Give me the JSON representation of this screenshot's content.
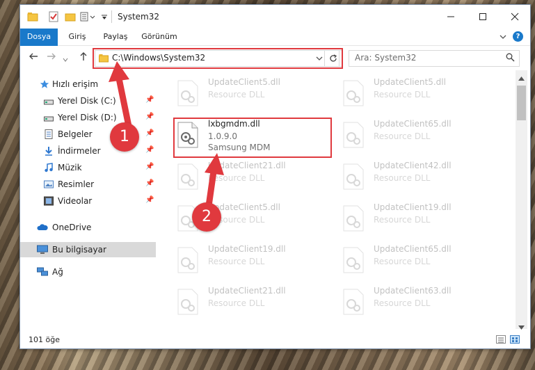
{
  "window": {
    "title": "System32"
  },
  "ribbon": {
    "tabs": [
      "Dosya",
      "Giriş",
      "Paylaş",
      "Görünüm"
    ]
  },
  "address": {
    "path": "C:\\Windows\\System32",
    "search_placeholder": "Ara: System32"
  },
  "sidebar": {
    "items": [
      {
        "label": "Hızlı erişim",
        "icon": "star-icon",
        "pinned": false
      },
      {
        "label": "Yerel Disk (C:)",
        "icon": "drive-icon",
        "pinned": true
      },
      {
        "label": "Yerel Disk (D:)",
        "icon": "drive-icon",
        "pinned": true
      },
      {
        "label": "Belgeler",
        "icon": "documents-icon",
        "pinned": true
      },
      {
        "label": "İndirmeler",
        "icon": "download-icon",
        "pinned": true
      },
      {
        "label": "Müzik",
        "icon": "music-icon",
        "pinned": true
      },
      {
        "label": "Resimler",
        "icon": "pictures-icon",
        "pinned": true
      },
      {
        "label": "Videolar",
        "icon": "video-icon",
        "pinned": true
      },
      {
        "label": "OneDrive",
        "icon": "cloud-icon",
        "pinned": false
      },
      {
        "label": "Bu bilgisayar",
        "icon": "computer-icon",
        "pinned": false,
        "selected": true
      },
      {
        "label": "Ağ",
        "icon": "network-icon",
        "pinned": false
      }
    ]
  },
  "files": [
    {
      "name": "UpdateClient5.dll",
      "sub": "Resource DLL",
      "faded": true
    },
    {
      "name": "UpdateClient5.dll",
      "sub": "Resource DLL",
      "faded": true
    },
    {
      "name": "lxbgmdm.dll",
      "sub": "1.0.9.0",
      "sub2": "Samsung MDM",
      "faded": false
    },
    {
      "name": "UpdateClient65.dll",
      "sub": "Resource DLL",
      "faded": true
    },
    {
      "name": "UpdateClient21.dll",
      "sub": "Resource DLL",
      "faded": true
    },
    {
      "name": "UpdateClient42.dll",
      "sub": "Resource DLL",
      "faded": true
    },
    {
      "name": "UpdateClient5.dll",
      "sub": "Resource DLL",
      "faded": true
    },
    {
      "name": "UpdateClient19.dll",
      "sub": "Resource DLL",
      "faded": true
    },
    {
      "name": "UpdateClient19.dll",
      "sub": "Resource DLL",
      "faded": true
    },
    {
      "name": "UpdateClient65.dll",
      "sub": "Resource DLL",
      "faded": true
    },
    {
      "name": "UpdateClient21.dll",
      "sub": "Resource DLL",
      "faded": true
    },
    {
      "name": "UpdateClient63.dll",
      "sub": "Resource DLL",
      "faded": true
    }
  ],
  "status": {
    "count": "101 öğe"
  },
  "annotations": {
    "step1": "1",
    "step2": "2"
  },
  "colors": {
    "accent": "#1979ca",
    "annotation_red": "#e0393e"
  }
}
